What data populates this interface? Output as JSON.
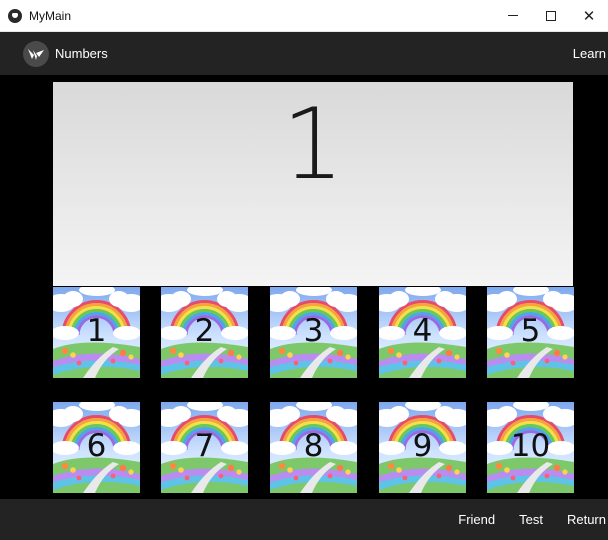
{
  "window": {
    "title": "MyMain",
    "controls": {
      "minimize": "–",
      "maximize": "□",
      "close": "✕"
    }
  },
  "actionbar": {
    "title": "Numbers",
    "learn_label": "Learn"
  },
  "display": {
    "number": "1"
  },
  "tiles": [
    "1",
    "2",
    "3",
    "4",
    "5",
    "6",
    "7",
    "8",
    "9",
    "10"
  ],
  "bottombar": {
    "friend_label": "Friend",
    "test_label": "Test",
    "return_label": "Return"
  },
  "colors": {
    "bar": "#232323",
    "background": "#000000",
    "display": "#e6e6e6",
    "text": "#ffffff"
  }
}
